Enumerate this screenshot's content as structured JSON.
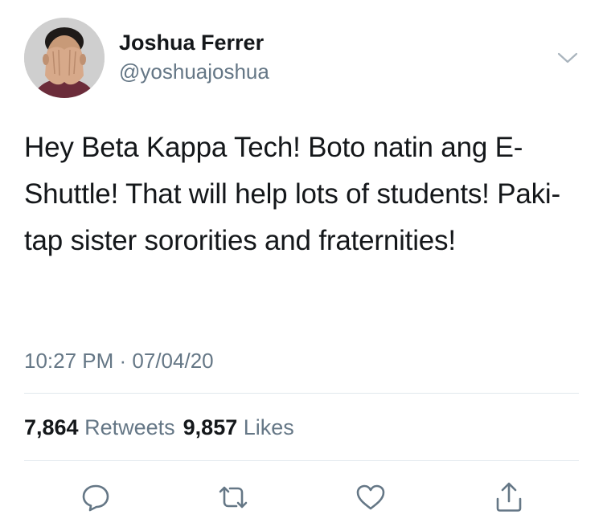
{
  "tweet": {
    "author": {
      "display_name": "Joshua Ferrer",
      "handle": "@yoshuajoshua"
    },
    "text": "Hey Beta Kappa Tech! Boto natin ang E-Shuttle! That will help lots of students! Paki-tap sister sororities and fraternities!",
    "time": "10:27 PM",
    "separator": " · ",
    "date": "07/04/20",
    "stats": {
      "retweets_count": "7,864",
      "retweets_label": "Retweets",
      "likes_count": "9,857",
      "likes_label": "Likes"
    },
    "actions": [
      {
        "icon": "reply-icon"
      },
      {
        "icon": "retweet-icon"
      },
      {
        "icon": "like-heart-icon"
      },
      {
        "icon": "share-icon"
      }
    ],
    "colors": {
      "primary_text": "#14171a",
      "secondary_text": "#657786",
      "divider": "#e1e8ed",
      "icon": "#657786"
    }
  }
}
